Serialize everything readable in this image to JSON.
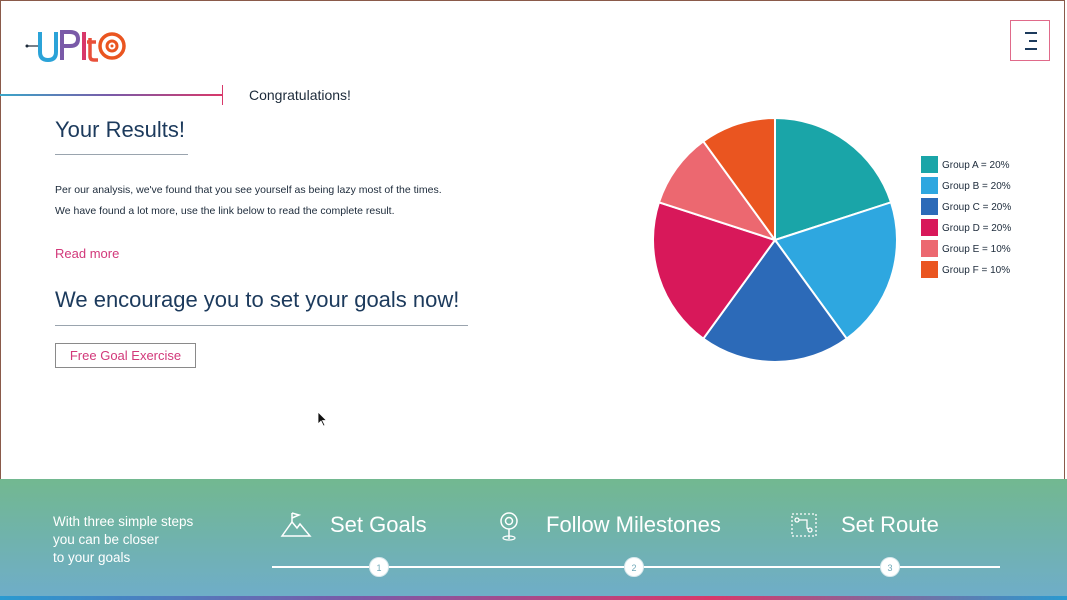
{
  "header": {
    "logo_text": "UPIt",
    "menu_icon": "hamburger-menu-icon"
  },
  "congrats": "Congratulations!",
  "results": {
    "title": "Your Results!",
    "line1": "Per our analysis, we've found that you see yourself as being lazy most of the times.",
    "line2": "We have found a lot more, use the link below to read the complete result.",
    "read_more": "Read more"
  },
  "encourage": {
    "title": "We encourage you to set your goals now!",
    "button": "Free Goal Exercise"
  },
  "chart_data": {
    "type": "pie",
    "title": "",
    "legend_position": "right",
    "slices": [
      {
        "name": "Group A = 20%",
        "value": 20,
        "color": "#1aa5a8"
      },
      {
        "name": "Group B = 20%",
        "value": 20,
        "color": "#2ea7e0"
      },
      {
        "name": "Group C = 20%",
        "value": 20,
        "color": "#2c6ab8"
      },
      {
        "name": "Group D = 20%",
        "value": 20,
        "color": "#d8185a"
      },
      {
        "name": "Group E = 10%",
        "value": 10,
        "color": "#ec6870"
      },
      {
        "name": "Group F = 10%",
        "value": 10,
        "color": "#ea5520"
      }
    ]
  },
  "footer": {
    "intro_line1": "With three simple steps",
    "intro_line2": "you can be closer",
    "intro_line3": "to your goals",
    "steps": [
      {
        "label": "Set Goals",
        "number": "1",
        "icon": "mountain-flag-icon"
      },
      {
        "label": "Follow Milestones",
        "number": "2",
        "icon": "location-pin-icon"
      },
      {
        "label": "Set Route",
        "number": "3",
        "icon": "route-map-icon"
      }
    ]
  }
}
